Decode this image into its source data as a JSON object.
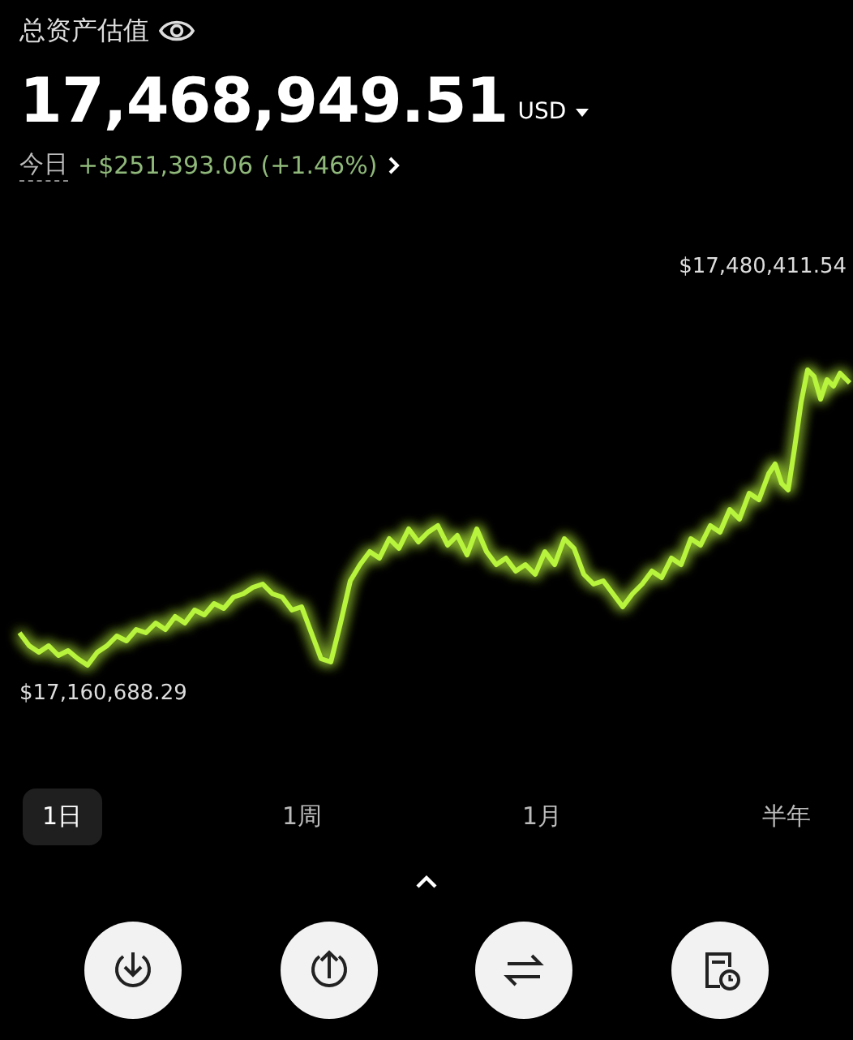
{
  "header": {
    "title": "总资产估值"
  },
  "balance": {
    "amount": "17,468,949.51",
    "currency": "USD"
  },
  "today": {
    "label": "今日",
    "change": "+$251,393.06 (+1.46%)"
  },
  "chart": {
    "kind": "picture",
    "max_label": "$17,480,411.54",
    "min_label": "$17,160,688.29"
  },
  "ranges": [
    {
      "label": "1日",
      "selected": true
    },
    {
      "label": "1周",
      "selected": false
    },
    {
      "label": "1月",
      "selected": false
    },
    {
      "label": "半年",
      "selected": false
    }
  ],
  "actions": [
    {
      "kind": "deposit"
    },
    {
      "kind": "withdraw"
    },
    {
      "kind": "transfer"
    },
    {
      "kind": "history"
    }
  ]
}
